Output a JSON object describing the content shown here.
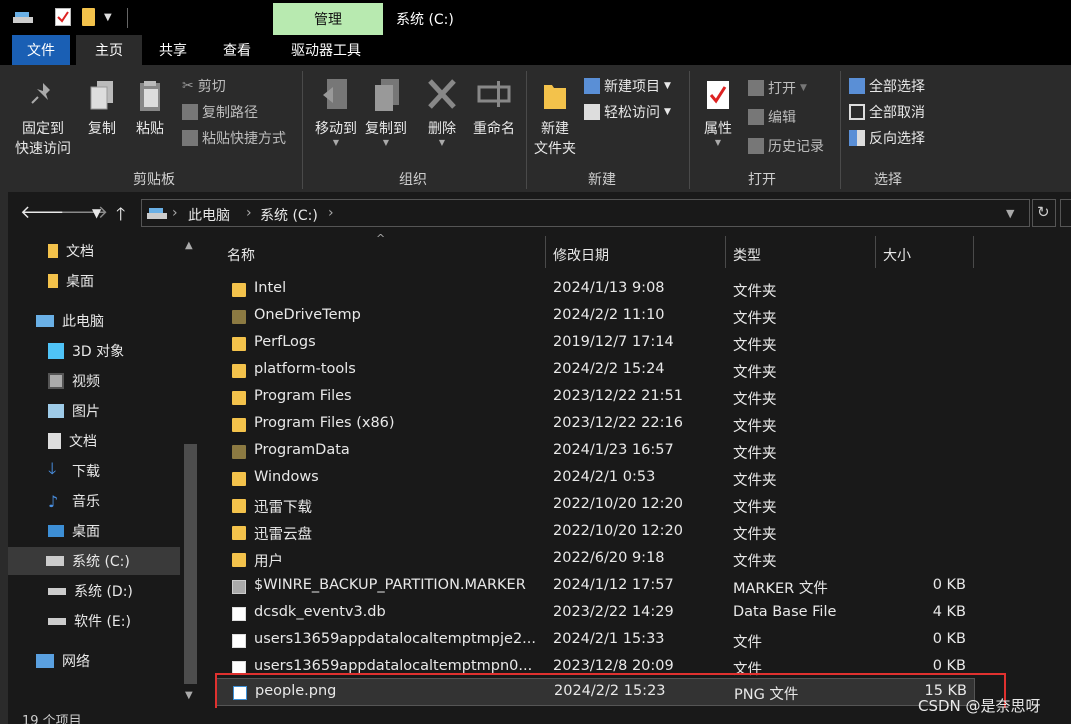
{
  "window": {
    "contextual_tab": "管理",
    "title": "系统 (C:)"
  },
  "tabs": {
    "file": "文件",
    "home": "主页",
    "share": "共享",
    "view": "查看",
    "drive_tools": "驱动器工具"
  },
  "ribbon": {
    "pin_line1": "固定到",
    "pin_line2": "快速访问",
    "copy": "复制",
    "paste": "粘贴",
    "cut": "剪切",
    "copy_path": "复制路径",
    "paste_shortcut": "粘贴快捷方式",
    "clipboard_group": "剪贴板",
    "move_to": "移动到",
    "copy_to": "复制到",
    "delete": "删除",
    "rename": "重命名",
    "organize_group": "组织",
    "new_folder_line1": "新建",
    "new_folder_line2": "文件夹",
    "new_item": "新建项目",
    "easy_access": "轻松访问",
    "new_group": "新建",
    "properties": "属性",
    "open": "打开",
    "edit": "编辑",
    "history": "历史记录",
    "open_group": "打开",
    "select_all": "全部选择",
    "select_none": "全部取消",
    "invert_selection": "反向选择",
    "select_group": "选择"
  },
  "address": {
    "crumb_pc": "此电脑",
    "crumb_drive": "系统 (C:)"
  },
  "nav": [
    {
      "label": "文档",
      "icon": "folder-icon"
    },
    {
      "label": "桌面",
      "icon": "folder-icon"
    },
    {
      "label": "此电脑",
      "icon": "computer-icon"
    },
    {
      "label": "3D 对象",
      "icon": "3d-objects-icon"
    },
    {
      "label": "视频",
      "icon": "video-icon"
    },
    {
      "label": "图片",
      "icon": "pictures-icon"
    },
    {
      "label": "文档",
      "icon": "documents-icon"
    },
    {
      "label": "下载",
      "icon": "download-icon"
    },
    {
      "label": "音乐",
      "icon": "music-icon"
    },
    {
      "label": "桌面",
      "icon": "desktop-icon"
    },
    {
      "label": "系统 (C:)",
      "icon": "system-drive-icon"
    },
    {
      "label": "系统 (D:)",
      "icon": "drive-icon"
    },
    {
      "label": "软件 (E:)",
      "icon": "drive-icon"
    },
    {
      "label": "网络",
      "icon": "network-icon"
    }
  ],
  "columns": {
    "name": "名称",
    "date": "修改日期",
    "type": "类型",
    "size": "大小"
  },
  "files": [
    {
      "name": "Intel",
      "date": "2024/1/13 9:08",
      "type": "文件夹",
      "size": "",
      "icon": "folder-icon"
    },
    {
      "name": "OneDriveTemp",
      "date": "2024/2/2 11:10",
      "type": "文件夹",
      "size": "",
      "icon": "hidden-folder-icon"
    },
    {
      "name": "PerfLogs",
      "date": "2019/12/7 17:14",
      "type": "文件夹",
      "size": "",
      "icon": "folder-icon"
    },
    {
      "name": "platform-tools",
      "date": "2024/2/2 15:24",
      "type": "文件夹",
      "size": "",
      "icon": "folder-icon"
    },
    {
      "name": "Program Files",
      "date": "2023/12/22 21:51",
      "type": "文件夹",
      "size": "",
      "icon": "folder-icon"
    },
    {
      "name": "Program Files (x86)",
      "date": "2023/12/22 22:16",
      "type": "文件夹",
      "size": "",
      "icon": "folder-icon"
    },
    {
      "name": "ProgramData",
      "date": "2024/1/23 16:57",
      "type": "文件夹",
      "size": "",
      "icon": "hidden-folder-icon"
    },
    {
      "name": "Windows",
      "date": "2024/2/1 0:53",
      "type": "文件夹",
      "size": "",
      "icon": "folder-icon"
    },
    {
      "name": "迅雷下载",
      "date": "2022/10/20 12:20",
      "type": "文件夹",
      "size": "",
      "icon": "folder-icon"
    },
    {
      "name": "迅雷云盘",
      "date": "2022/10/20 12:20",
      "type": "文件夹",
      "size": "",
      "icon": "folder-icon"
    },
    {
      "name": "用户",
      "date": "2022/6/20 9:18",
      "type": "文件夹",
      "size": "",
      "icon": "folder-icon"
    },
    {
      "name": "$WINRE_BACKUP_PARTITION.MARKER",
      "date": "2024/1/12 17:57",
      "type": "MARKER 文件",
      "size": "0 KB",
      "icon": "hidden-file-icon"
    },
    {
      "name": "dcsdk_eventv3.db",
      "date": "2023/2/22 14:29",
      "type": "Data Base File",
      "size": "4 KB",
      "icon": "db-file-icon"
    },
    {
      "name": "users13659appdatalocaltemptmpje2...",
      "date": "2024/2/1 15:33",
      "type": "文件",
      "size": "0 KB",
      "icon": "file-icon"
    },
    {
      "name": "users13659appdatalocaltemptmpn0...",
      "date": "2023/12/8 20:09",
      "type": "文件",
      "size": "0 KB",
      "icon": "file-icon"
    },
    {
      "name": "people.png",
      "date": "2024/2/2 15:23",
      "type": "PNG 文件",
      "size": "15 KB",
      "icon": "png-file-icon"
    }
  ],
  "status": {
    "item_count": "19 个项目"
  },
  "watermark": "CSDN @是奈思呀"
}
